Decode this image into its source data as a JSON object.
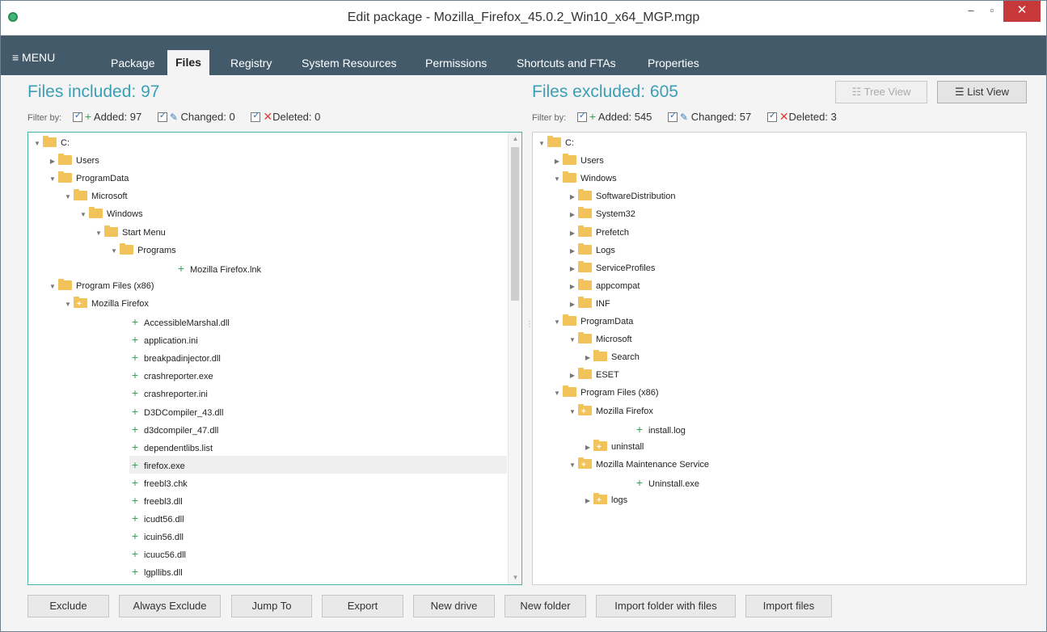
{
  "window": {
    "title": "Edit package - Mozilla_Firefox_45.0.2_Win10_x64_MGP.mgp"
  },
  "menu": {
    "label": "≡ MENU"
  },
  "tabs": [
    {
      "label": "Package"
    },
    {
      "label": "Files",
      "active": true
    },
    {
      "label": "Registry"
    },
    {
      "label": "System Resources"
    },
    {
      "label": "Permissions"
    },
    {
      "label": "Shortcuts and FTAs"
    },
    {
      "label": "Properties"
    }
  ],
  "left": {
    "title": "Files included: 97",
    "filter_label": "Filter by:",
    "filters": {
      "added": "Added: 97",
      "changed": "Changed: 0",
      "deleted": "Deleted: 0"
    },
    "tree": [
      {
        "label": "C:",
        "depth": 0,
        "type": "folder",
        "expanded": true
      },
      {
        "label": "Users",
        "depth": 1,
        "type": "folder",
        "expanded": false
      },
      {
        "label": "ProgramData",
        "depth": 1,
        "type": "folder",
        "expanded": true
      },
      {
        "label": "Microsoft",
        "depth": 2,
        "type": "folder",
        "expanded": true
      },
      {
        "label": "Windows",
        "depth": 3,
        "type": "folder",
        "expanded": true
      },
      {
        "label": "Start Menu",
        "depth": 4,
        "type": "folder",
        "expanded": true
      },
      {
        "label": "Programs",
        "depth": 5,
        "type": "folder",
        "expanded": true
      },
      {
        "label": "Mozilla Firefox.lnk",
        "depth": 6,
        "type": "file"
      },
      {
        "label": "Program Files (x86)",
        "depth": 1,
        "type": "folder",
        "expanded": true
      },
      {
        "label": "Mozilla Firefox",
        "depth": 2,
        "type": "special",
        "expanded": true
      },
      {
        "label": "AccessibleMarshal.dll",
        "depth": 3,
        "type": "file"
      },
      {
        "label": "application.ini",
        "depth": 3,
        "type": "file"
      },
      {
        "label": "breakpadinjector.dll",
        "depth": 3,
        "type": "file"
      },
      {
        "label": "crashreporter.exe",
        "depth": 3,
        "type": "file"
      },
      {
        "label": "crashreporter.ini",
        "depth": 3,
        "type": "file"
      },
      {
        "label": "D3DCompiler_43.dll",
        "depth": 3,
        "type": "file"
      },
      {
        "label": "d3dcompiler_47.dll",
        "depth": 3,
        "type": "file"
      },
      {
        "label": "dependentlibs.list",
        "depth": 3,
        "type": "file"
      },
      {
        "label": "firefox.exe",
        "depth": 3,
        "type": "file",
        "selected": true
      },
      {
        "label": "freebl3.chk",
        "depth": 3,
        "type": "file"
      },
      {
        "label": "freebl3.dll",
        "depth": 3,
        "type": "file"
      },
      {
        "label": "icudt56.dll",
        "depth": 3,
        "type": "file"
      },
      {
        "label": "icuin56.dll",
        "depth": 3,
        "type": "file"
      },
      {
        "label": "icuuc56.dll",
        "depth": 3,
        "type": "file"
      },
      {
        "label": "lgpllibs.dll",
        "depth": 3,
        "type": "file"
      }
    ]
  },
  "right": {
    "title": "Files excluded: 605",
    "filter_label": "Filter by:",
    "filters": {
      "added": "Added: 545",
      "changed": "Changed: 57",
      "deleted": "Deleted: 3"
    },
    "tree_view_label": "Tree View",
    "list_view_label": "List View",
    "tree": [
      {
        "label": "C:",
        "depth": 0,
        "type": "folder",
        "expanded": true
      },
      {
        "label": "Users",
        "depth": 1,
        "type": "folder",
        "expanded": false
      },
      {
        "label": "Windows",
        "depth": 1,
        "type": "folder",
        "expanded": true
      },
      {
        "label": "SoftwareDistribution",
        "depth": 2,
        "type": "folder",
        "expanded": false
      },
      {
        "label": "System32",
        "depth": 2,
        "type": "folder",
        "expanded": false
      },
      {
        "label": "Prefetch",
        "depth": 2,
        "type": "folder",
        "expanded": false
      },
      {
        "label": "Logs",
        "depth": 2,
        "type": "folder",
        "expanded": false
      },
      {
        "label": "ServiceProfiles",
        "depth": 2,
        "type": "folder",
        "expanded": false
      },
      {
        "label": "appcompat",
        "depth": 2,
        "type": "folder",
        "expanded": false
      },
      {
        "label": "INF",
        "depth": 2,
        "type": "folder",
        "expanded": false
      },
      {
        "label": "ProgramData",
        "depth": 1,
        "type": "folder",
        "expanded": true
      },
      {
        "label": "Microsoft",
        "depth": 2,
        "type": "folder",
        "expanded": true
      },
      {
        "label": "Search",
        "depth": 3,
        "type": "folder",
        "expanded": false
      },
      {
        "label": "ESET",
        "depth": 2,
        "type": "folder",
        "expanded": false
      },
      {
        "label": "Program Files (x86)",
        "depth": 1,
        "type": "folder",
        "expanded": true
      },
      {
        "label": "Mozilla Firefox",
        "depth": 2,
        "type": "special",
        "expanded": true
      },
      {
        "label": "install.log",
        "depth": 3,
        "type": "file"
      },
      {
        "label": "uninstall",
        "depth": 3,
        "type": "special",
        "expanded": false
      },
      {
        "label": "Mozilla Maintenance Service",
        "depth": 2,
        "type": "special",
        "expanded": true
      },
      {
        "label": "Uninstall.exe",
        "depth": 3,
        "type": "file"
      },
      {
        "label": "logs",
        "depth": 3,
        "type": "special",
        "expanded": false
      }
    ]
  },
  "buttons": [
    {
      "label": "Exclude"
    },
    {
      "label": "Always Exclude"
    },
    {
      "label": "Jump To"
    },
    {
      "label": "Export"
    },
    {
      "label": "New drive"
    },
    {
      "label": "New folder"
    },
    {
      "label": "Import folder with files"
    },
    {
      "label": "Import files"
    }
  ]
}
